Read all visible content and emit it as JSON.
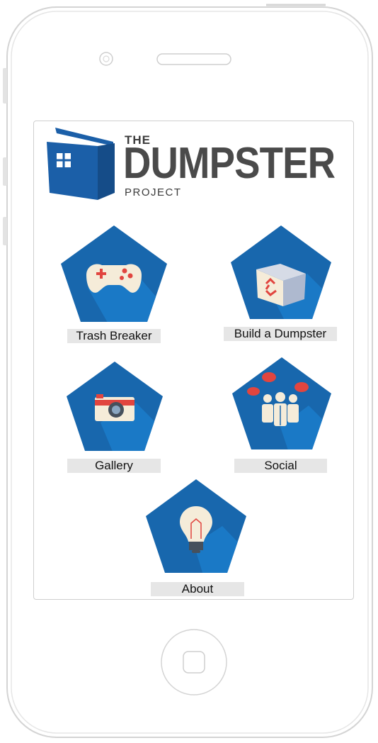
{
  "logo": {
    "line1": "THE",
    "line2": "DUMPSTER",
    "line3": "PROJECT"
  },
  "menu": {
    "items": [
      {
        "label": "Trash Breaker",
        "icon": "gamepad-icon"
      },
      {
        "label": "Build a Dumpster",
        "icon": "recycle-box-icon"
      },
      {
        "label": "Gallery",
        "icon": "camera-icon"
      },
      {
        "label": "Social",
        "icon": "people-icon"
      },
      {
        "label": "About",
        "icon": "lightbulb-icon"
      }
    ]
  },
  "colors": {
    "pentagon": "#1867ad",
    "pentagon_shadow": "#1a79c6",
    "logo_blue": "#1b5fa8",
    "text_dark": "#4a4a4a",
    "label_bg": "#e6e6e6"
  }
}
